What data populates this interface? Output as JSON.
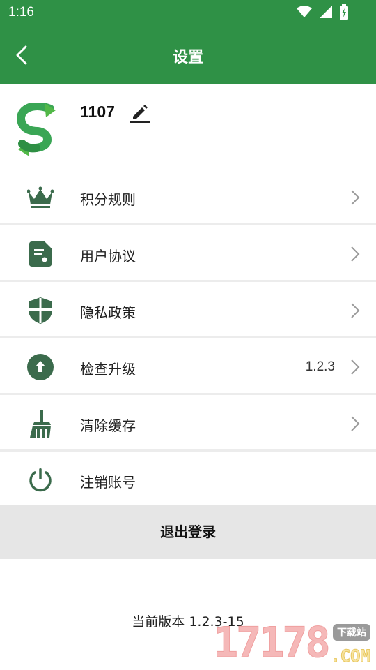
{
  "status_bar": {
    "time": "1:16"
  },
  "app_bar": {
    "title": "设置"
  },
  "profile": {
    "username": "1107"
  },
  "menu": {
    "items": [
      {
        "label": "积分规则",
        "icon": "crown-icon",
        "value": ""
      },
      {
        "label": "用户协议",
        "icon": "document-icon",
        "value": ""
      },
      {
        "label": "隐私政策",
        "icon": "shield-icon",
        "value": ""
      },
      {
        "label": "检查升级",
        "icon": "upgrade-icon",
        "value": "1.2.3"
      },
      {
        "label": "清除缓存",
        "icon": "broom-icon",
        "value": ""
      },
      {
        "label": "注销账号",
        "icon": "power-icon",
        "value": ""
      }
    ]
  },
  "logout": {
    "label": "退出登录"
  },
  "footer": {
    "version": "当前版本 1.2.3-15"
  },
  "watermark": {
    "digits": "17178",
    "badge": "下载站",
    "suffix": ".COM"
  },
  "colors": {
    "primary": "#2f9146",
    "icon": "#3b6b4c",
    "divider": "#ececec",
    "logout_bg": "#e6e6e6"
  }
}
